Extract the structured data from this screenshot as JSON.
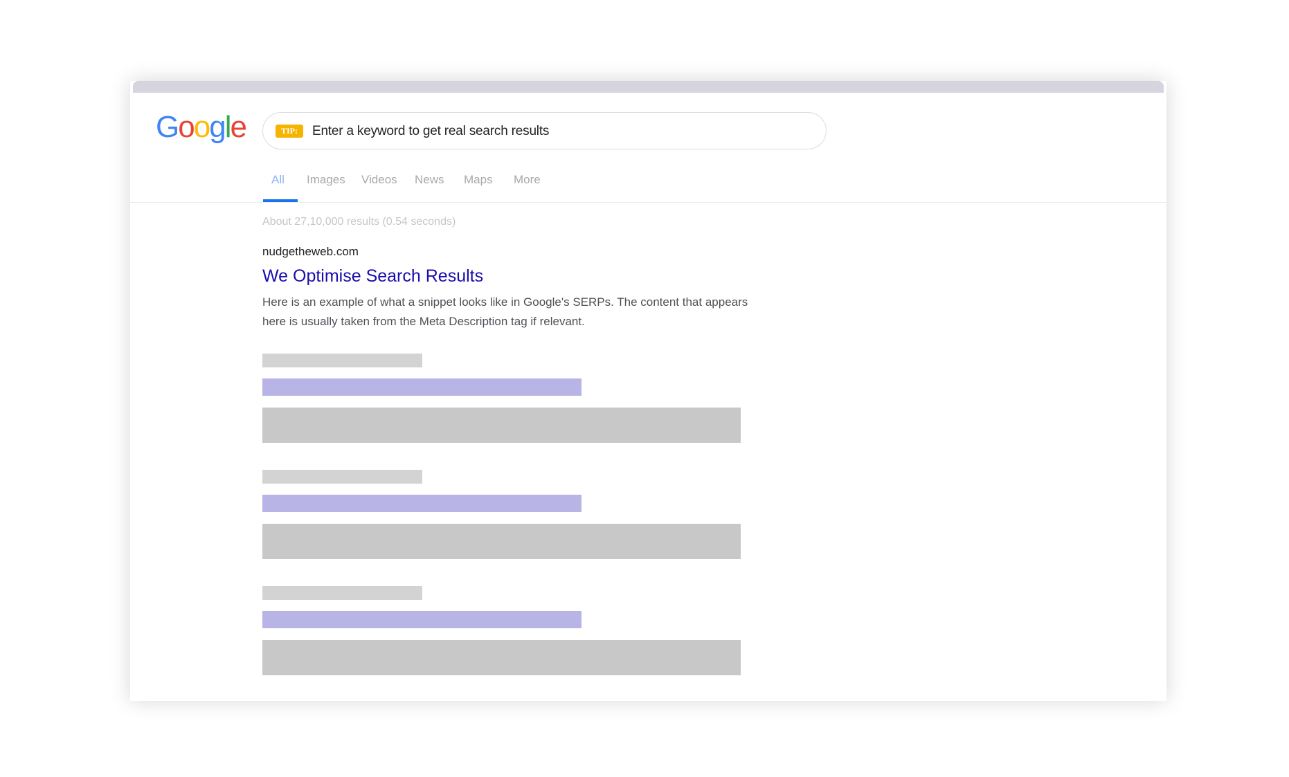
{
  "logo": {
    "letters": [
      {
        "char": "G",
        "color": "#4285F4"
      },
      {
        "char": "o",
        "color": "#EA4335"
      },
      {
        "char": "o",
        "color": "#FBBC05"
      },
      {
        "char": "g",
        "color": "#4285F4"
      },
      {
        "char": "l",
        "color": "#34A853"
      },
      {
        "char": "e",
        "color": "#EA4335"
      }
    ]
  },
  "search": {
    "tip_label": "TIP:",
    "text": "Enter a keyword to get real search results"
  },
  "tabs": [
    {
      "label": "All",
      "active": true
    },
    {
      "label": "Images",
      "active": false
    },
    {
      "label": "Videos",
      "active": false
    },
    {
      "label": "News",
      "active": false
    },
    {
      "label": "Maps",
      "active": false
    },
    {
      "label": "More",
      "active": false
    }
  ],
  "results": {
    "stats": "About 27,10,000 results (0.54 seconds)",
    "first": {
      "url": "nudgetheweb.com",
      "title": "We Optimise Search Results",
      "snippet_line1": "Here is an example of what a snippet looks like in Google's SERPs. The content that appears",
      "snippet_line2": "here is usually taken from the Meta Description tag if relevant."
    },
    "placeholder_count": 3
  },
  "colors": {
    "accent": "#1a73e8",
    "link": "#1a0dab",
    "tip": "#f5b400",
    "placeholder_title": "#b8b4e6",
    "placeholder_gray": "#c8c8c9"
  }
}
